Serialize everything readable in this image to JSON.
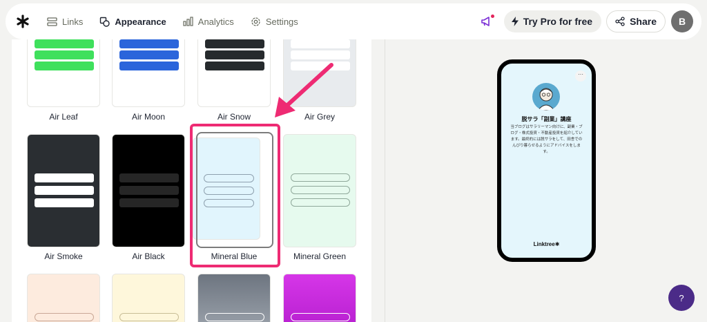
{
  "nav": {
    "links": "Links",
    "appearance": "Appearance",
    "analytics": "Analytics",
    "settings": "Settings",
    "try_pro": "Try Pro for free",
    "share": "Share",
    "avatar_initial": "B"
  },
  "themes": [
    {
      "name": "Air Leaf",
      "bg": "#ffffff",
      "button": "#3fe05c"
    },
    {
      "name": "Air Moon",
      "bg": "#ffffff",
      "button": "#2b65db"
    },
    {
      "name": "Air Snow",
      "bg": "#ffffff",
      "button": "#262a2d"
    },
    {
      "name": "Air Grey",
      "bg": "#e8ebee",
      "button": "#ffffff"
    },
    {
      "name": "Air Smoke",
      "bg": "#2a2e32",
      "button": "#ffffff"
    },
    {
      "name": "Air Black",
      "bg": "#000000",
      "button": "#262626"
    },
    {
      "name": "Mineral Blue",
      "bg": "#e1f5fd",
      "button": "outline"
    },
    {
      "name": "Mineral Green",
      "bg": "#e6faee",
      "button": "outline"
    },
    {
      "name": "",
      "bg": "#fdebde",
      "button": "outline"
    },
    {
      "name": "",
      "bg": "#fef7db",
      "button": "outline"
    },
    {
      "name": "",
      "bg": "#6d7580",
      "button": "outline"
    },
    {
      "name": "",
      "bg": "#d636e8",
      "button": "outline"
    }
  ],
  "selected_theme": "Mineral Blue",
  "preview": {
    "profile_name": "脱サラ「副業」講座",
    "bio": "当ブログはサラリーマン向けに、副業・ブログ・株式投資・不動産投資を紹介しています。最終的には脱サラをして、田舎でのんびり暮らせるようにアドバイスをします。",
    "more": "···",
    "brand": "Linktree✱"
  },
  "help": {
    "label": "?"
  },
  "colors": {
    "accent": "#ee2b73",
    "help_button": "#4b2b88"
  }
}
